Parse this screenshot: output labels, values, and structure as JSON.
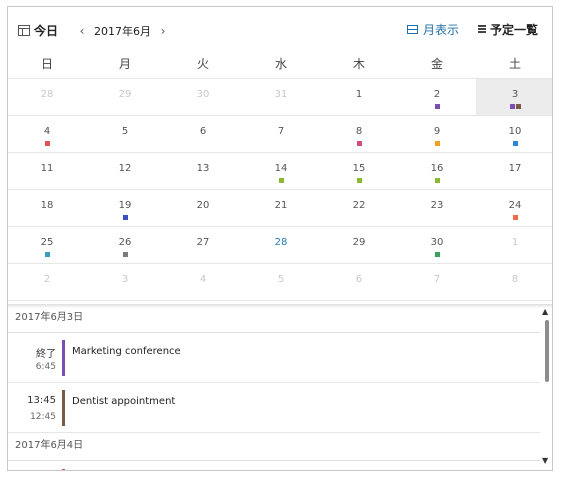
{
  "toolbar": {
    "today_label": "今日",
    "month_label": "2017年6月",
    "prev_icon": "chevron-left",
    "next_icon": "chevron-right",
    "month_view_label": "月表示",
    "agenda_label": "予定一覧"
  },
  "colors": {
    "accent": "#1f6fa8",
    "selected_bg": "#ececec"
  },
  "weekdays": [
    "日",
    "月",
    "火",
    "水",
    "木",
    "金",
    "土"
  ],
  "weeks": [
    [
      {
        "n": "28",
        "other": true
      },
      {
        "n": "29",
        "other": true
      },
      {
        "n": "30",
        "other": true
      },
      {
        "n": "31",
        "other": true
      },
      {
        "n": "1"
      },
      {
        "n": "2",
        "dots": [
          "#7a4fb5"
        ]
      },
      {
        "n": "3",
        "selected": true,
        "dots": [
          "#7a4fb5",
          "#7a5a42"
        ]
      }
    ],
    [
      {
        "n": "4",
        "dots": [
          "#e05454"
        ]
      },
      {
        "n": "5"
      },
      {
        "n": "6"
      },
      {
        "n": "7"
      },
      {
        "n": "8",
        "dots": [
          "#d6497a"
        ]
      },
      {
        "n": "9",
        "dots": [
          "#f0a020"
        ]
      },
      {
        "n": "10",
        "dots": [
          "#2e86d6"
        ]
      }
    ],
    [
      {
        "n": "11"
      },
      {
        "n": "12"
      },
      {
        "n": "13"
      },
      {
        "n": "14",
        "dots": [
          "#8cb832"
        ]
      },
      {
        "n": "15",
        "dots": [
          "#8cb832"
        ]
      },
      {
        "n": "16",
        "dots": [
          "#8cb832"
        ]
      },
      {
        "n": "17"
      }
    ],
    [
      {
        "n": "18"
      },
      {
        "n": "19",
        "dots": [
          "#3a4fc0"
        ]
      },
      {
        "n": "20"
      },
      {
        "n": "21"
      },
      {
        "n": "22"
      },
      {
        "n": "23"
      },
      {
        "n": "24",
        "dots": [
          "#ee6a4a"
        ]
      }
    ],
    [
      {
        "n": "25",
        "dots": [
          "#3a9bbf"
        ]
      },
      {
        "n": "26",
        "dots": [
          "#7a7a7a"
        ]
      },
      {
        "n": "27"
      },
      {
        "n": "28",
        "today": true
      },
      {
        "n": "29"
      },
      {
        "n": "30",
        "dots": [
          "#3aa060"
        ]
      },
      {
        "n": "1",
        "other": true
      }
    ],
    [
      {
        "n": "2",
        "other": true
      },
      {
        "n": "3",
        "other": true
      },
      {
        "n": "4",
        "other": true
      },
      {
        "n": "5",
        "other": true
      },
      {
        "n": "6",
        "other": true
      },
      {
        "n": "7",
        "other": true
      },
      {
        "n": "8",
        "other": true
      }
    ]
  ],
  "agenda": {
    "day1_header": "2017年6月3日",
    "events": [
      {
        "start": "終了",
        "end": "6:45",
        "title": "Marketing conference",
        "color": "#7a4fb5"
      },
      {
        "start": "13:45",
        "end": "12:45",
        "title": "Dentist appointment",
        "color": "#7a5a42"
      }
    ],
    "day2_header": "2017年6月4日"
  },
  "scrollbar": {
    "up_icon": "chevron-up",
    "down_icon": "chevron-down"
  }
}
